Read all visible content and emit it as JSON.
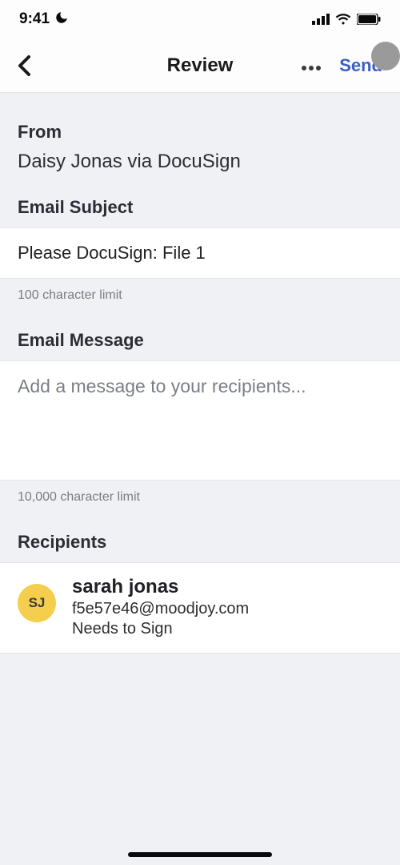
{
  "status": {
    "time": "9:41"
  },
  "nav": {
    "title": "Review",
    "send": "Send"
  },
  "from": {
    "label": "From",
    "value": "Daisy Jonas via DocuSign"
  },
  "subject": {
    "label": "Email Subject",
    "value": "Please DocuSign: File 1",
    "helper": "100 character limit"
  },
  "message": {
    "label": "Email Message",
    "placeholder": "Add a message to your recipients...",
    "helper": "10,000 character limit"
  },
  "recipients": {
    "label": "Recipients",
    "items": [
      {
        "initials": "SJ",
        "name": "sarah jonas",
        "email": "f5e57e46@moodjoy.com",
        "status": "Needs to Sign"
      }
    ]
  }
}
